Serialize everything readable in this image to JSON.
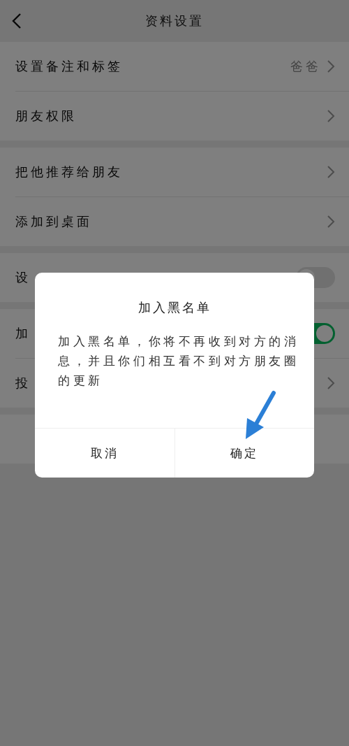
{
  "header": {
    "title": "资料设置"
  },
  "groups": [
    {
      "rows": [
        {
          "kind": "link",
          "label": "设置备注和标签",
          "value": "爸爸"
        },
        {
          "kind": "link",
          "label": "朋友权限"
        }
      ]
    },
    {
      "rows": [
        {
          "kind": "link",
          "label": "把他推荐给朋友"
        },
        {
          "kind": "link",
          "label": "添加到桌面"
        }
      ]
    },
    {
      "rows": [
        {
          "kind": "toggle",
          "label": "设",
          "on": false
        }
      ]
    },
    {
      "rows": [
        {
          "kind": "toggle",
          "label": "加",
          "on": true
        },
        {
          "kind": "link",
          "label": "投"
        }
      ]
    },
    {
      "rows": [
        {
          "kind": "blank"
        }
      ]
    }
  ],
  "dialog": {
    "title": "加入黑名单",
    "message": "加入黑名单，你将不再收到对方的消息，并且你们相互看不到对方朋友圈的更新",
    "buttons": [
      "取消",
      "确定"
    ]
  }
}
